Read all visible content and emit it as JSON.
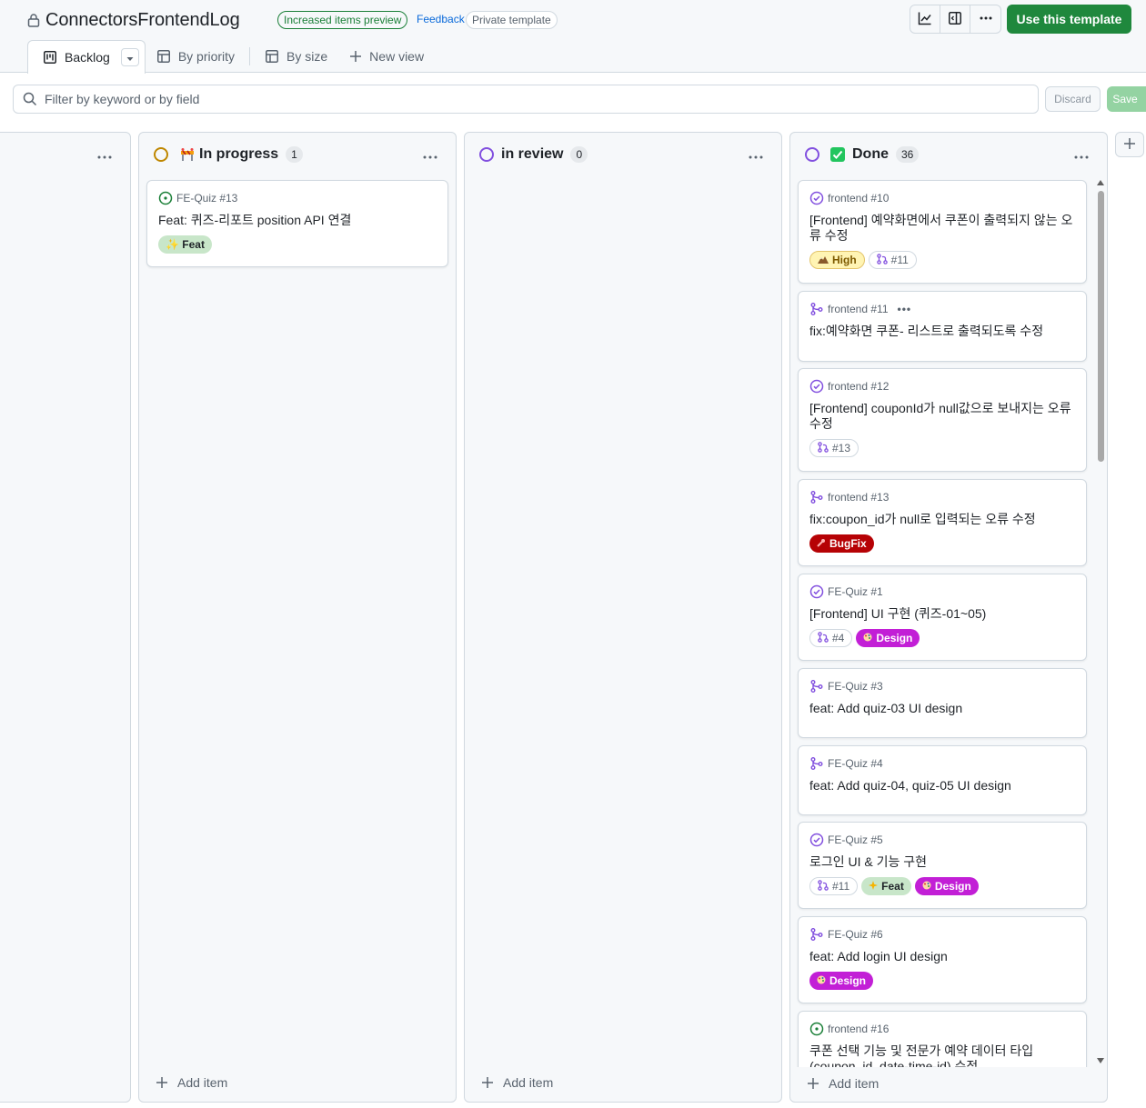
{
  "header": {
    "project_title": "ConnectorsFrontendLog",
    "preview_badge": "Increased items preview",
    "feedback_link": "Feedback",
    "template_badge": "Private template",
    "use_template_button": "Use this template"
  },
  "tabs": [
    {
      "label": "Backlog",
      "active": true
    },
    {
      "label": "By priority"
    },
    {
      "label": "By size"
    },
    {
      "label": "New view"
    }
  ],
  "filter": {
    "placeholder": "Filter by keyword or by field",
    "discard_label": "Discard",
    "save_label": "Save"
  },
  "columns": {
    "in_progress": {
      "title": "In progress",
      "count": "1",
      "status_color": "#bf8700",
      "add_item_label": "Add item",
      "cards": [
        {
          "repo": "FE-Quiz #13",
          "title": "Feat: 퀴즈-리포트 position API 연결",
          "labels": [
            "✨ Feat"
          ]
        }
      ]
    },
    "in_review": {
      "title": "in review",
      "count": "0",
      "status_color": "#8250df",
      "add_item_label": "Add item"
    },
    "done": {
      "title": "Done",
      "count": "36",
      "status_color": "#8250df",
      "add_item_label": "Add item",
      "cards": [
        {
          "repo": "frontend #10",
          "title": "[Frontend] 예약화면에서 쿠폰이 출력되지 않는 오류 수정",
          "labels": [
            "High",
            "#11"
          ]
        },
        {
          "repo": "frontend #11",
          "title": "fix:예약화면 쿠폰- 리스트로 출력되도록 수정",
          "more": "•••"
        },
        {
          "repo": "frontend #12",
          "title": "[Frontend] couponId가 null값으로 보내지는 오류 수정",
          "labels": [
            "#13"
          ]
        },
        {
          "repo": "frontend #13",
          "title": "fix:coupon_id가 null로 입력되는 오류 수정",
          "labels": [
            "BugFix"
          ]
        },
        {
          "repo": "FE-Quiz #1",
          "title": "[Frontend] UI 구현 (퀴즈-01~05)",
          "labels": [
            "#4",
            "Design"
          ]
        },
        {
          "repo": "FE-Quiz #3",
          "title": "feat: Add quiz-03 UI design"
        },
        {
          "repo": "FE-Quiz #4",
          "title": "feat: Add quiz-04, quiz-05 UI design"
        },
        {
          "repo": "FE-Quiz #5",
          "title": "로그인 UI & 기능 구현",
          "labels": [
            "#11",
            "Feat",
            "Design"
          ]
        },
        {
          "repo": "FE-Quiz #6",
          "title": "feat: Add login UI design",
          "labels": [
            "Design"
          ]
        },
        {
          "repo": "frontend #16",
          "title": "쿠폰 선택 기능 및 전문가 예약 데이터 타입 (coupon_id, date-time-id) 수정"
        }
      ]
    }
  },
  "colors": {
    "accent_green": "#1f883d",
    "issue_open": "#1a7f37",
    "issue_closed": "#8250df",
    "design_label": "#c21fd6",
    "bugfix_label": "#b60205"
  }
}
